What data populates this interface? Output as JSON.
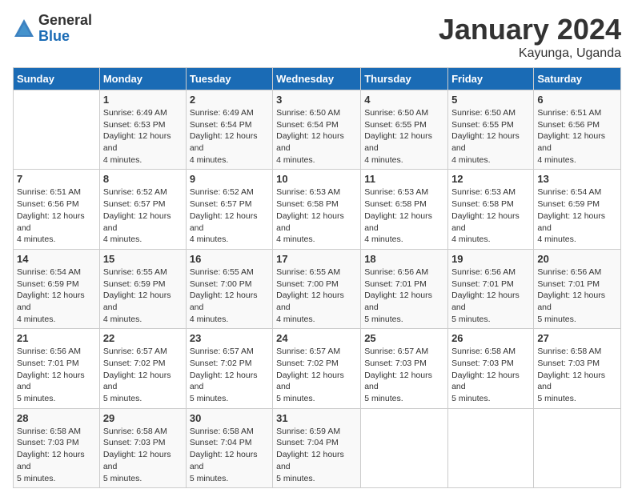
{
  "logo": {
    "general": "General",
    "blue": "Blue"
  },
  "title": "January 2024",
  "subtitle": "Kayunga, Uganda",
  "headers": [
    "Sunday",
    "Monday",
    "Tuesday",
    "Wednesday",
    "Thursday",
    "Friday",
    "Saturday"
  ],
  "weeks": [
    [
      {
        "day": "",
        "sunrise": "",
        "sunset": "",
        "daylight": ""
      },
      {
        "day": "1",
        "sunrise": "Sunrise: 6:49 AM",
        "sunset": "Sunset: 6:53 PM",
        "daylight": "Daylight: 12 hours and 4 minutes."
      },
      {
        "day": "2",
        "sunrise": "Sunrise: 6:49 AM",
        "sunset": "Sunset: 6:54 PM",
        "daylight": "Daylight: 12 hours and 4 minutes."
      },
      {
        "day": "3",
        "sunrise": "Sunrise: 6:50 AM",
        "sunset": "Sunset: 6:54 PM",
        "daylight": "Daylight: 12 hours and 4 minutes."
      },
      {
        "day": "4",
        "sunrise": "Sunrise: 6:50 AM",
        "sunset": "Sunset: 6:55 PM",
        "daylight": "Daylight: 12 hours and 4 minutes."
      },
      {
        "day": "5",
        "sunrise": "Sunrise: 6:50 AM",
        "sunset": "Sunset: 6:55 PM",
        "daylight": "Daylight: 12 hours and 4 minutes."
      },
      {
        "day": "6",
        "sunrise": "Sunrise: 6:51 AM",
        "sunset": "Sunset: 6:56 PM",
        "daylight": "Daylight: 12 hours and 4 minutes."
      }
    ],
    [
      {
        "day": "7",
        "sunrise": "Sunrise: 6:51 AM",
        "sunset": "Sunset: 6:56 PM",
        "daylight": "Daylight: 12 hours and 4 minutes."
      },
      {
        "day": "8",
        "sunrise": "Sunrise: 6:52 AM",
        "sunset": "Sunset: 6:57 PM",
        "daylight": "Daylight: 12 hours and 4 minutes."
      },
      {
        "day": "9",
        "sunrise": "Sunrise: 6:52 AM",
        "sunset": "Sunset: 6:57 PM",
        "daylight": "Daylight: 12 hours and 4 minutes."
      },
      {
        "day": "10",
        "sunrise": "Sunrise: 6:53 AM",
        "sunset": "Sunset: 6:58 PM",
        "daylight": "Daylight: 12 hours and 4 minutes."
      },
      {
        "day": "11",
        "sunrise": "Sunrise: 6:53 AM",
        "sunset": "Sunset: 6:58 PM",
        "daylight": "Daylight: 12 hours and 4 minutes."
      },
      {
        "day": "12",
        "sunrise": "Sunrise: 6:53 AM",
        "sunset": "Sunset: 6:58 PM",
        "daylight": "Daylight: 12 hours and 4 minutes."
      },
      {
        "day": "13",
        "sunrise": "Sunrise: 6:54 AM",
        "sunset": "Sunset: 6:59 PM",
        "daylight": "Daylight: 12 hours and 4 minutes."
      }
    ],
    [
      {
        "day": "14",
        "sunrise": "Sunrise: 6:54 AM",
        "sunset": "Sunset: 6:59 PM",
        "daylight": "Daylight: 12 hours and 4 minutes."
      },
      {
        "day": "15",
        "sunrise": "Sunrise: 6:55 AM",
        "sunset": "Sunset: 6:59 PM",
        "daylight": "Daylight: 12 hours and 4 minutes."
      },
      {
        "day": "16",
        "sunrise": "Sunrise: 6:55 AM",
        "sunset": "Sunset: 7:00 PM",
        "daylight": "Daylight: 12 hours and 4 minutes."
      },
      {
        "day": "17",
        "sunrise": "Sunrise: 6:55 AM",
        "sunset": "Sunset: 7:00 PM",
        "daylight": "Daylight: 12 hours and 4 minutes."
      },
      {
        "day": "18",
        "sunrise": "Sunrise: 6:56 AM",
        "sunset": "Sunset: 7:01 PM",
        "daylight": "Daylight: 12 hours and 5 minutes."
      },
      {
        "day": "19",
        "sunrise": "Sunrise: 6:56 AM",
        "sunset": "Sunset: 7:01 PM",
        "daylight": "Daylight: 12 hours and 5 minutes."
      },
      {
        "day": "20",
        "sunrise": "Sunrise: 6:56 AM",
        "sunset": "Sunset: 7:01 PM",
        "daylight": "Daylight: 12 hours and 5 minutes."
      }
    ],
    [
      {
        "day": "21",
        "sunrise": "Sunrise: 6:56 AM",
        "sunset": "Sunset: 7:01 PM",
        "daylight": "Daylight: 12 hours and 5 minutes."
      },
      {
        "day": "22",
        "sunrise": "Sunrise: 6:57 AM",
        "sunset": "Sunset: 7:02 PM",
        "daylight": "Daylight: 12 hours and 5 minutes."
      },
      {
        "day": "23",
        "sunrise": "Sunrise: 6:57 AM",
        "sunset": "Sunset: 7:02 PM",
        "daylight": "Daylight: 12 hours and 5 minutes."
      },
      {
        "day": "24",
        "sunrise": "Sunrise: 6:57 AM",
        "sunset": "Sunset: 7:02 PM",
        "daylight": "Daylight: 12 hours and 5 minutes."
      },
      {
        "day": "25",
        "sunrise": "Sunrise: 6:57 AM",
        "sunset": "Sunset: 7:03 PM",
        "daylight": "Daylight: 12 hours and 5 minutes."
      },
      {
        "day": "26",
        "sunrise": "Sunrise: 6:58 AM",
        "sunset": "Sunset: 7:03 PM",
        "daylight": "Daylight: 12 hours and 5 minutes."
      },
      {
        "day": "27",
        "sunrise": "Sunrise: 6:58 AM",
        "sunset": "Sunset: 7:03 PM",
        "daylight": "Daylight: 12 hours and 5 minutes."
      }
    ],
    [
      {
        "day": "28",
        "sunrise": "Sunrise: 6:58 AM",
        "sunset": "Sunset: 7:03 PM",
        "daylight": "Daylight: 12 hours and 5 minutes."
      },
      {
        "day": "29",
        "sunrise": "Sunrise: 6:58 AM",
        "sunset": "Sunset: 7:03 PM",
        "daylight": "Daylight: 12 hours and 5 minutes."
      },
      {
        "day": "30",
        "sunrise": "Sunrise: 6:58 AM",
        "sunset": "Sunset: 7:04 PM",
        "daylight": "Daylight: 12 hours and 5 minutes."
      },
      {
        "day": "31",
        "sunrise": "Sunrise: 6:59 AM",
        "sunset": "Sunset: 7:04 PM",
        "daylight": "Daylight: 12 hours and 5 minutes."
      },
      {
        "day": "",
        "sunrise": "",
        "sunset": "",
        "daylight": ""
      },
      {
        "day": "",
        "sunrise": "",
        "sunset": "",
        "daylight": ""
      },
      {
        "day": "",
        "sunrise": "",
        "sunset": "",
        "daylight": ""
      }
    ]
  ]
}
